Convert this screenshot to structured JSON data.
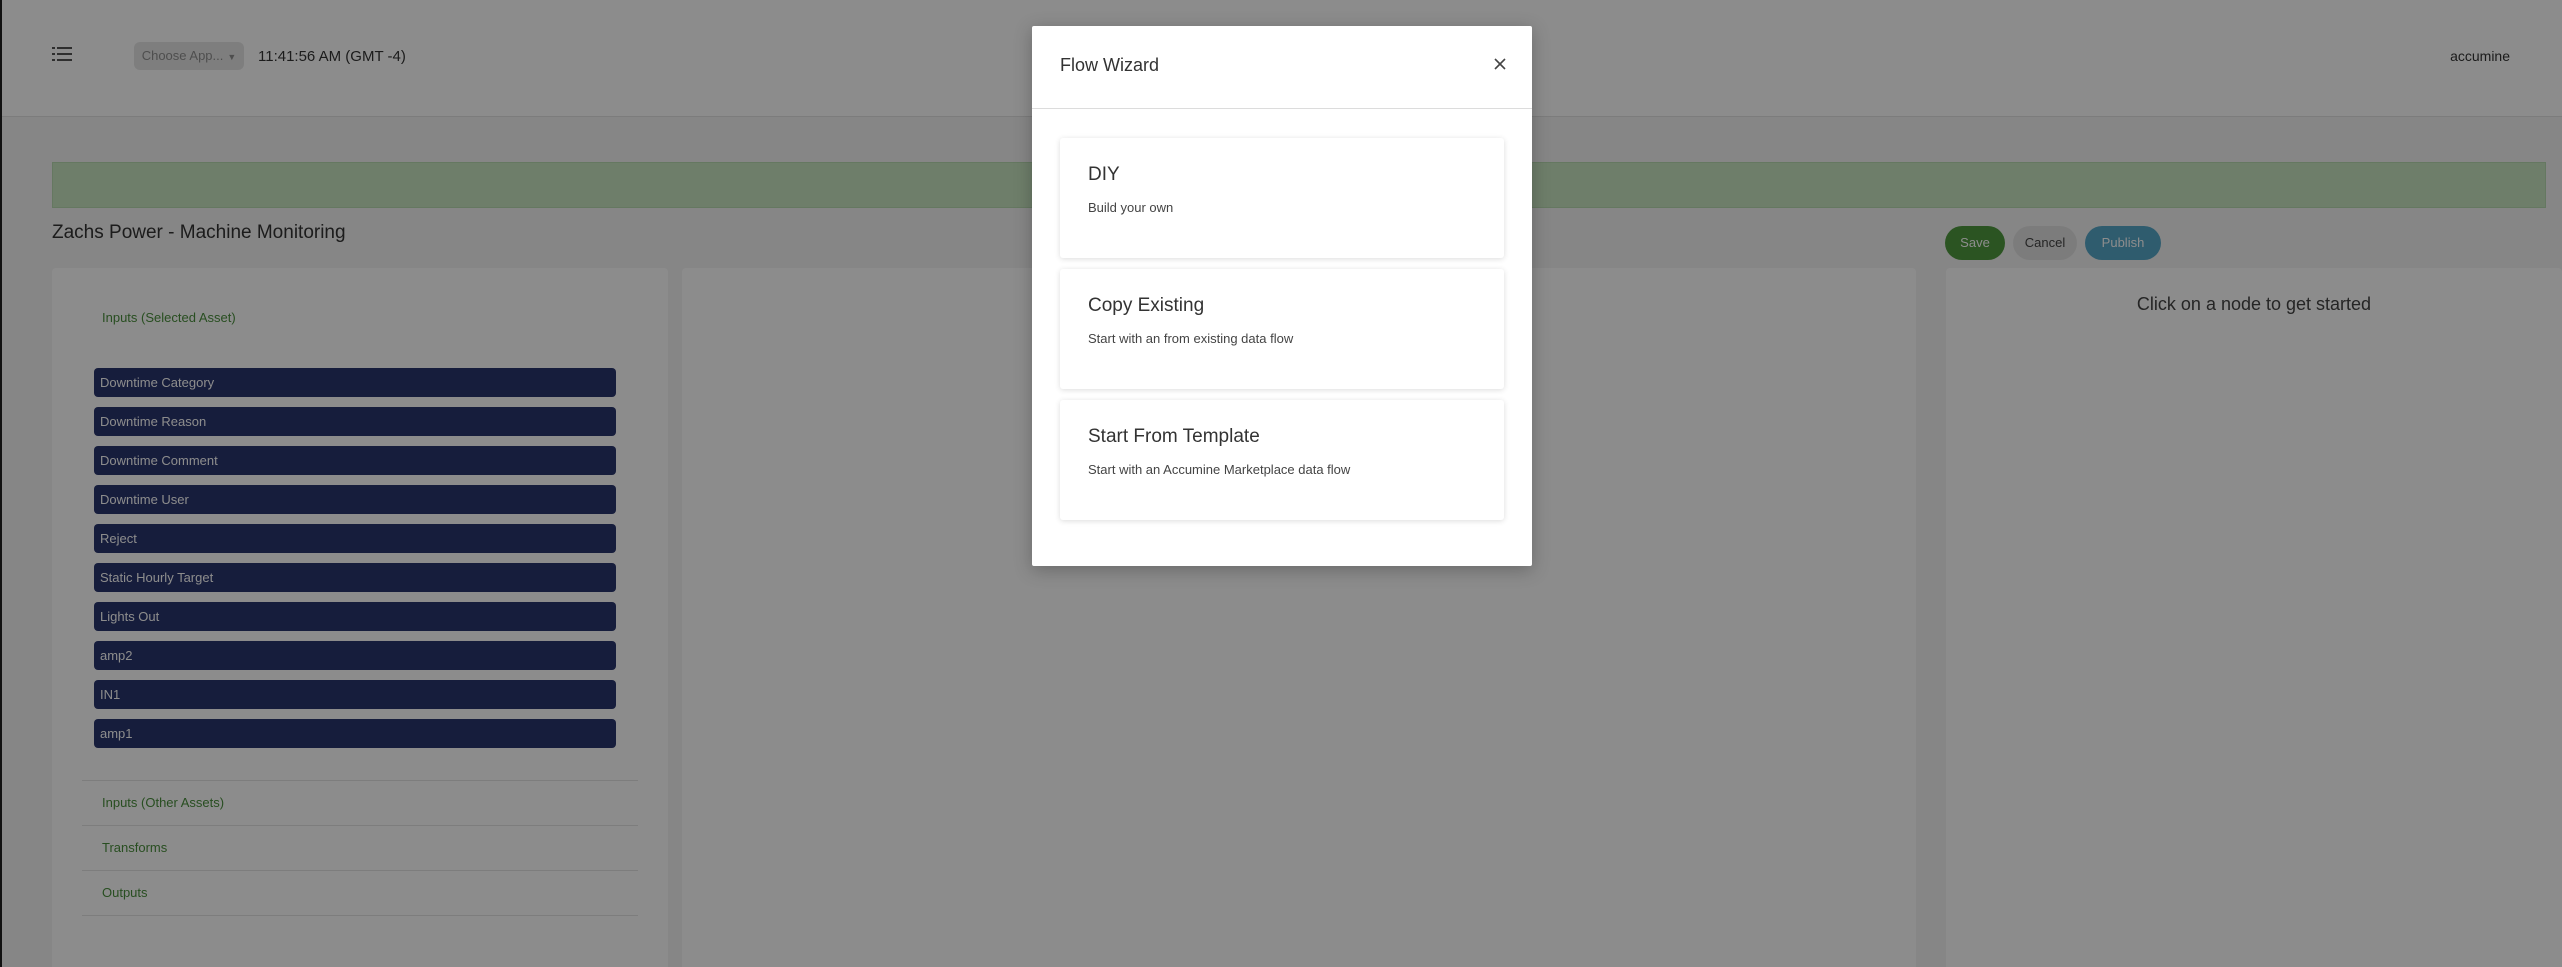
{
  "header": {
    "app_select_label": "Choose App...",
    "clock": "11:41:56 AM (GMT -4)",
    "user": "accumine"
  },
  "page": {
    "title": "Zachs Power - Machine Monitoring"
  },
  "actions": {
    "save": "Save",
    "cancel": "Cancel",
    "publish": "Publish"
  },
  "sidebar": {
    "sections": [
      "Inputs (Selected Asset)",
      "Inputs (Other Assets)",
      "Transforms",
      "Outputs"
    ],
    "inputs": [
      "Downtime Category",
      "Downtime Reason",
      "Downtime Comment",
      "Downtime User",
      "Reject",
      "Static Hourly Target",
      "Lights Out",
      "amp2",
      "IN1",
      "amp1"
    ]
  },
  "details_panel": {
    "hint": "Click on a node to get started"
  },
  "modal": {
    "title": "Flow Wizard",
    "options": [
      {
        "title": "DIY",
        "description": "Build your own"
      },
      {
        "title": "Copy Existing",
        "description": "Start with an from existing data flow"
      },
      {
        "title": "Start From Template",
        "description": "Start with an Accumine Marketplace data flow"
      }
    ]
  },
  "colors": {
    "banner": "#c8e6c2",
    "save": "#4f9a3f",
    "publish": "#56a8c8",
    "input_pill": "#29356e",
    "section_link": "#4a8f3c"
  },
  "icons": {
    "menu": "list-menu-icon",
    "close": "close-icon",
    "caret": "caret-down-icon"
  }
}
